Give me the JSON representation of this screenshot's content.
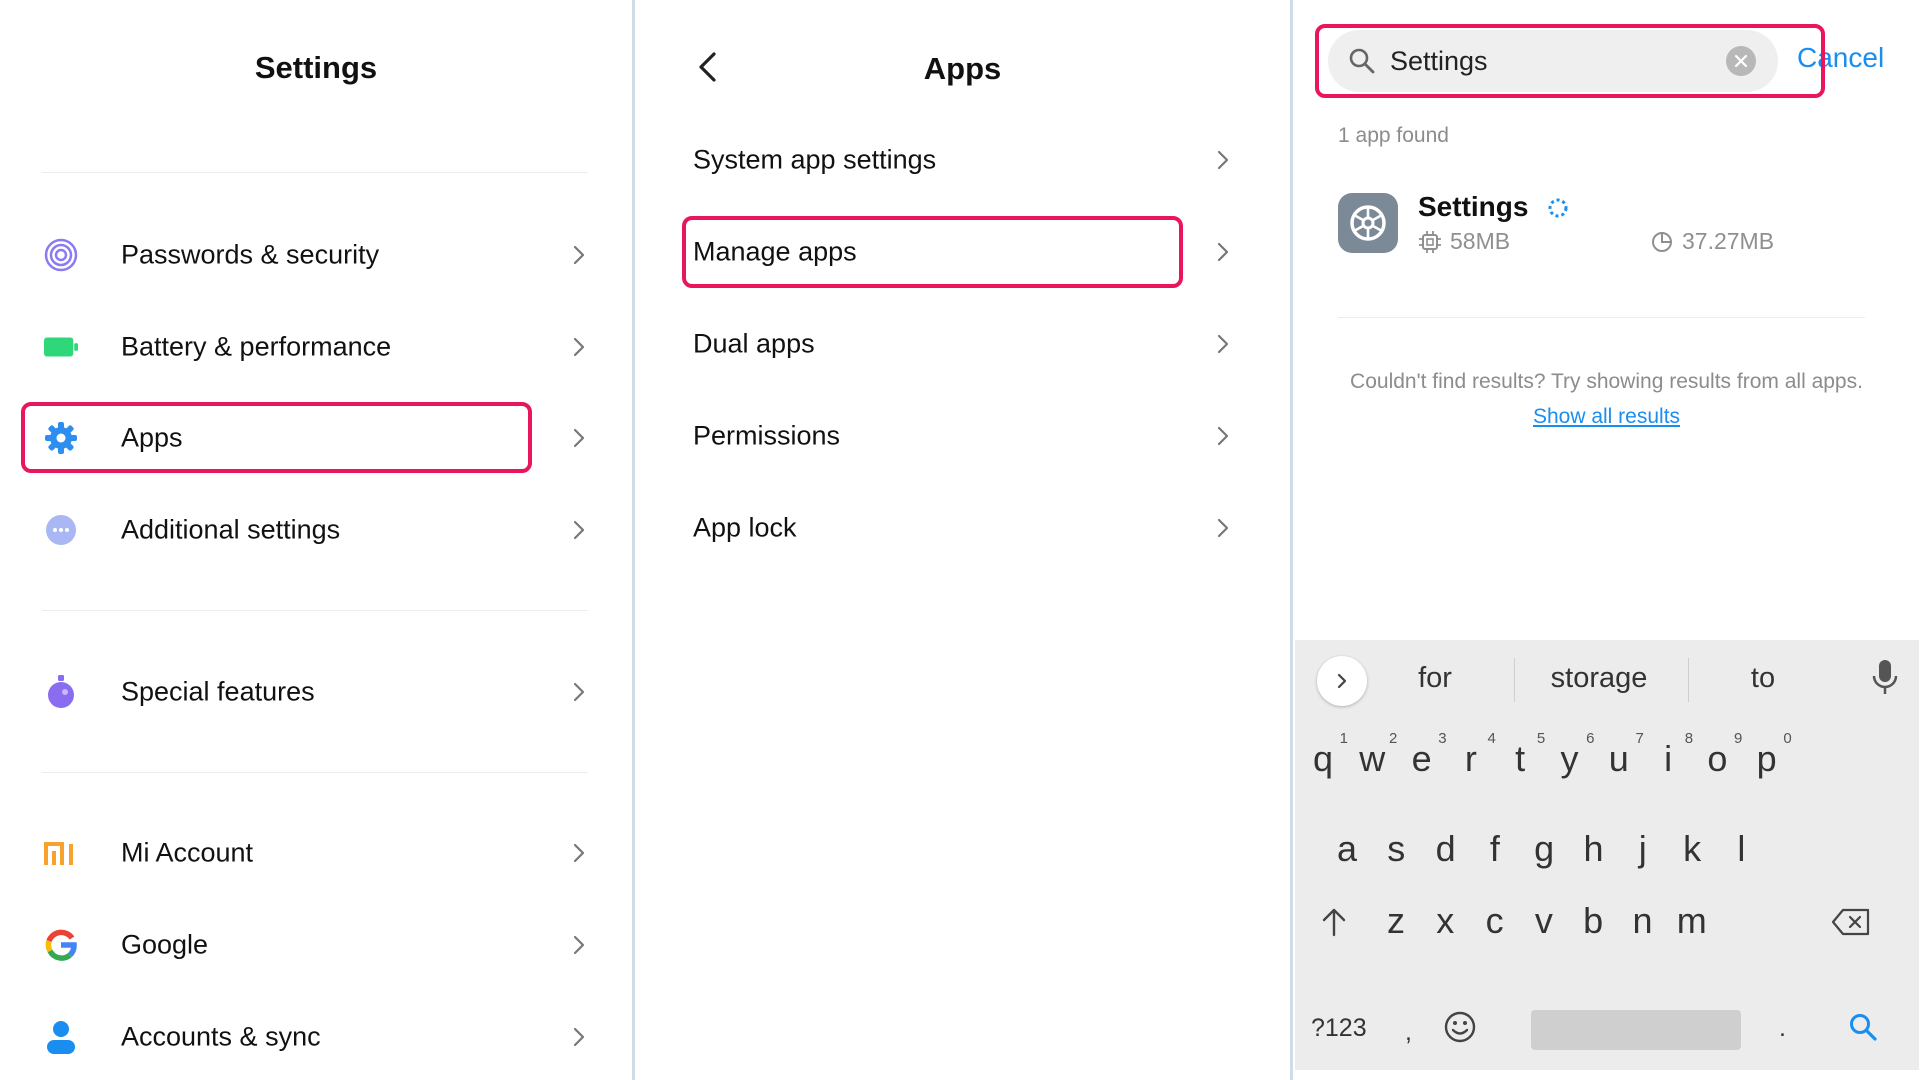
{
  "settings_panel": {
    "title": "Settings",
    "items": [
      {
        "label": "Passwords & security",
        "icon": "fingerprint-icon"
      },
      {
        "label": "Battery & performance",
        "icon": "battery-icon"
      },
      {
        "label": "Apps",
        "icon": "gear-icon"
      },
      {
        "label": "Additional settings",
        "icon": "more-dots-icon"
      },
      {
        "label": "Special features",
        "icon": "special-features-icon"
      },
      {
        "label": "Mi Account",
        "icon": "mi-logo-icon"
      },
      {
        "label": "Google",
        "icon": "google-logo-icon"
      },
      {
        "label": "Accounts & sync",
        "icon": "user-icon"
      }
    ],
    "highlighted_item": "Apps"
  },
  "apps_panel": {
    "title": "Apps",
    "items": [
      {
        "label": "System app settings"
      },
      {
        "label": "Manage apps"
      },
      {
        "label": "Dual apps"
      },
      {
        "label": "Permissions"
      },
      {
        "label": "App lock"
      }
    ],
    "highlighted_item": "Manage apps"
  },
  "search_panel": {
    "query": "Settings",
    "cancel_label": "Cancel",
    "results_count": "1 app found",
    "result": {
      "name": "Settings",
      "app_size": "58MB",
      "storage_size": "37.27MB"
    },
    "no_results_hint": "Couldn't find results? Try showing results from all apps.",
    "show_all_label": "Show all results"
  },
  "keyboard": {
    "suggestions": [
      "for",
      "storage",
      "to"
    ],
    "row1": [
      {
        "k": "q",
        "n": "1"
      },
      {
        "k": "w",
        "n": "2"
      },
      {
        "k": "e",
        "n": "3"
      },
      {
        "k": "r",
        "n": "4"
      },
      {
        "k": "t",
        "n": "5"
      },
      {
        "k": "y",
        "n": "6"
      },
      {
        "k": "u",
        "n": "7"
      },
      {
        "k": "i",
        "n": "8"
      },
      {
        "k": "o",
        "n": "9"
      },
      {
        "k": "p",
        "n": "0"
      }
    ],
    "row2": [
      "a",
      "s",
      "d",
      "f",
      "g",
      "h",
      "j",
      "k",
      "l"
    ],
    "row3": [
      "z",
      "x",
      "c",
      "v",
      "b",
      "n",
      "m"
    ],
    "symbols_label": "?123",
    "comma_label": ",",
    "period_label": "."
  },
  "colors": {
    "highlight": "#e8175d",
    "accent_blue": "#1a8ef0",
    "battery_green": "#2fd67a",
    "mi_orange": "#f7a12e",
    "purple": "#8a7cf0"
  }
}
